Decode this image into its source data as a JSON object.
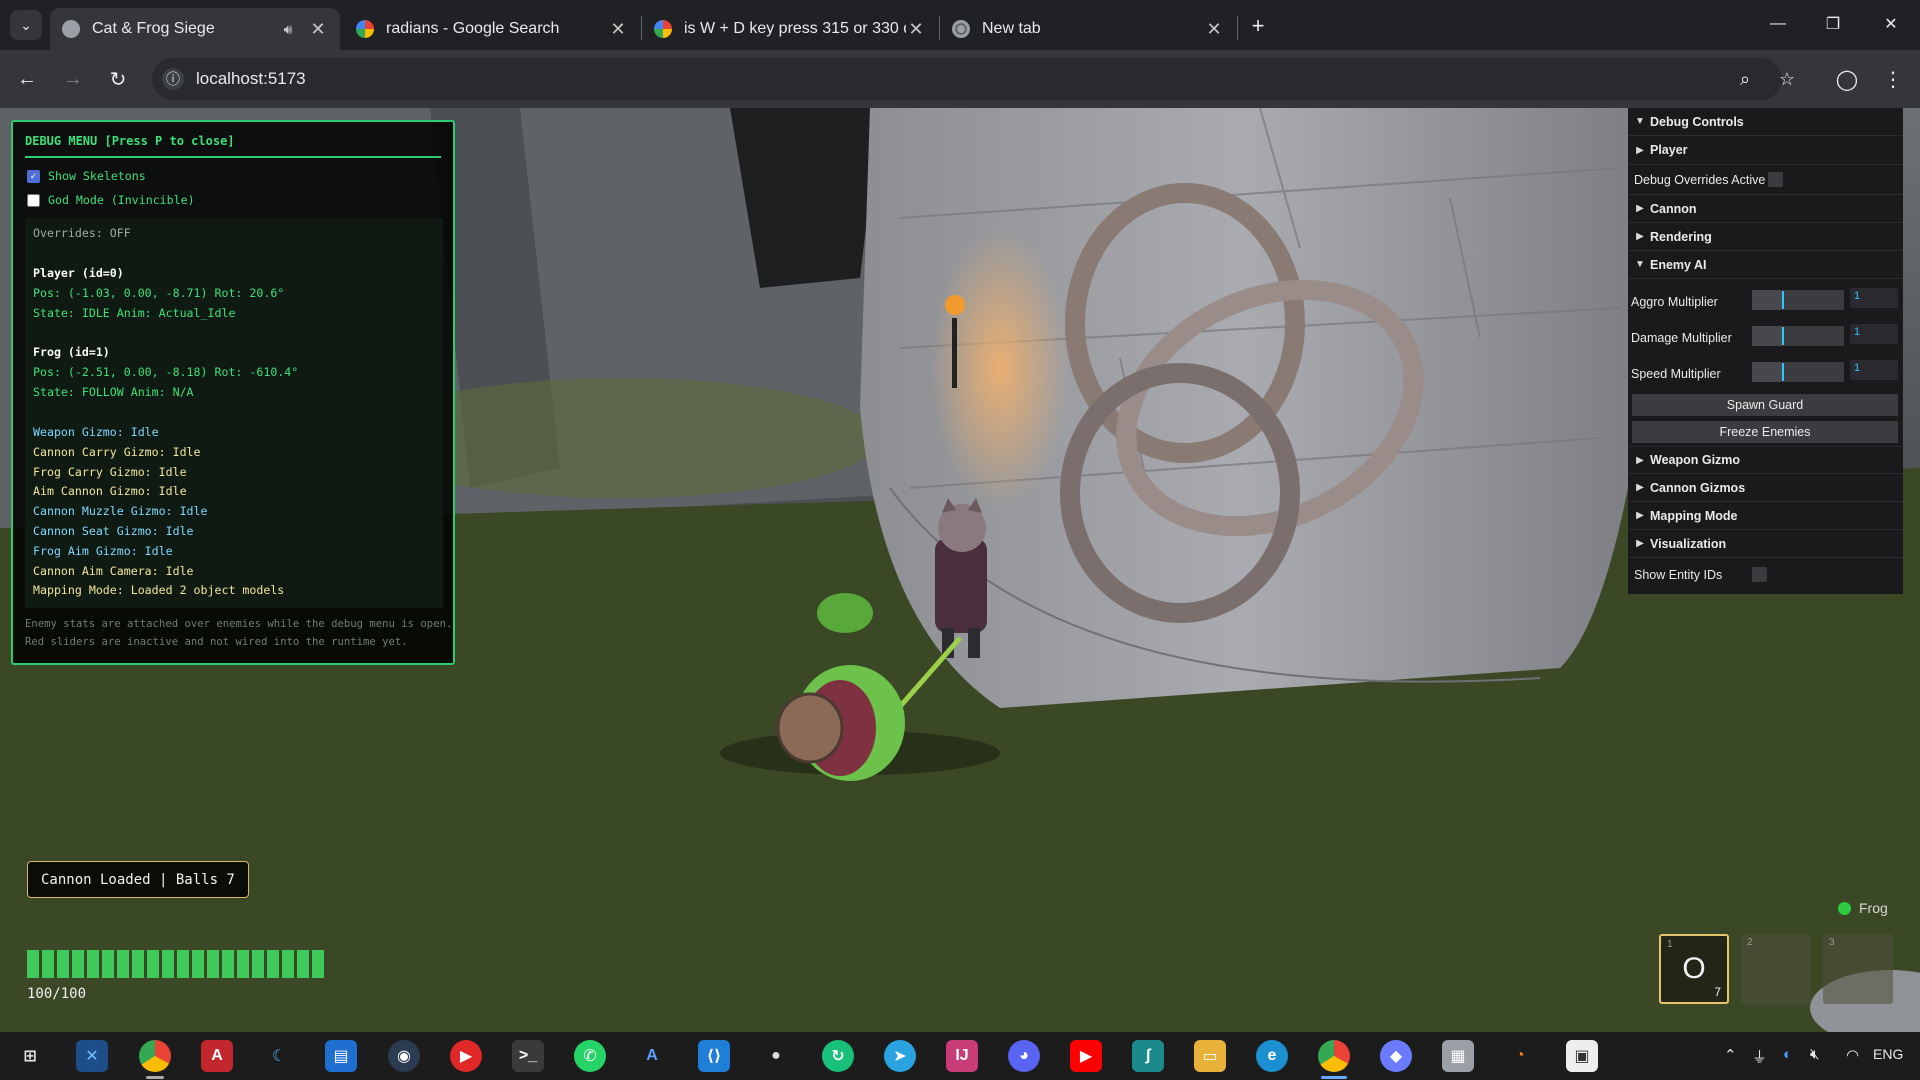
{
  "browser": {
    "tabs": [
      {
        "title": "Cat & Frog Siege",
        "active": true
      },
      {
        "title": "radians - Google Search",
        "active": false
      },
      {
        "title": "is W + D key press 315 or 330 d",
        "active": false
      },
      {
        "title": "New tab",
        "active": false
      }
    ],
    "url": "localhost:5173"
  },
  "debug_menu": {
    "title": "DEBUG MENU [Press P to close]",
    "show_skeletons": {
      "label": "Show Skeletons",
      "checked": true
    },
    "god_mode": {
      "label": "God Mode (Invincible)",
      "checked": false
    },
    "overrides": "Overrides: OFF",
    "player_header": "Player (id=0)",
    "player_pos": "Pos: (-1.03, 0.00, -8.71) Rot: 20.6°",
    "player_state": "State: IDLE Anim: Actual_Idle",
    "frog_header": "Frog (id=1)",
    "frog_pos": "Pos: (-2.51, 0.00, -8.18) Rot: -610.4°",
    "frog_state": "State: FOLLOW Anim: N/A",
    "gizmos": [
      "Weapon Gizmo: Idle",
      "Cannon Carry Gizmo: Idle",
      "Frog Carry Gizmo: Idle",
      "Aim Cannon Gizmo: Idle",
      "Cannon Muzzle Gizmo: Idle",
      "Cannon Seat Gizmo: Idle",
      "Frog Aim Gizmo: Idle",
      "Cannon Aim Camera: Idle",
      "Mapping Mode: Loaded 2 object models"
    ],
    "footer_1": "Enemy stats are attached over enemies while the debug menu is open.",
    "footer_2": "Red sliders are inactive and not wired into the runtime yet."
  },
  "controls": {
    "debug_controls": "Debug Controls",
    "player": "Player",
    "overrides_label": "Debug Overrides Active",
    "cannon": "Cannon",
    "rendering": "Rendering",
    "enemy_ai": "Enemy AI",
    "aggro": {
      "label": "Aggro Multiplier",
      "value": "1"
    },
    "damage": {
      "label": "Damage Multiplier",
      "value": "1"
    },
    "speed": {
      "label": "Speed Multiplier",
      "value": "1"
    },
    "spawn_guard": "Spawn Guard",
    "freeze_enemies": "Freeze Enemies",
    "weapon_gizmo": "Weapon Gizmo",
    "cannon_gizmos": "Cannon Gizmos",
    "mapping_mode": "Mapping Mode",
    "visualization": "Visualization",
    "show_entity_ids": "Show Entity IDs"
  },
  "hud": {
    "cannon_status": "Cannon Loaded | Balls 7",
    "health_fraction": 1.0,
    "health_text": "100/100",
    "companion": "Frog",
    "slots": [
      {
        "index": "1",
        "glyph": "O",
        "count": "7"
      },
      {
        "index": "2"
      },
      {
        "index": "3"
      }
    ]
  },
  "colors": {
    "debug_green": "#2ecc71",
    "health_green": "#3fc95a",
    "slider_accent": "#2cc6ff",
    "slot_border": "#e7c66b"
  }
}
